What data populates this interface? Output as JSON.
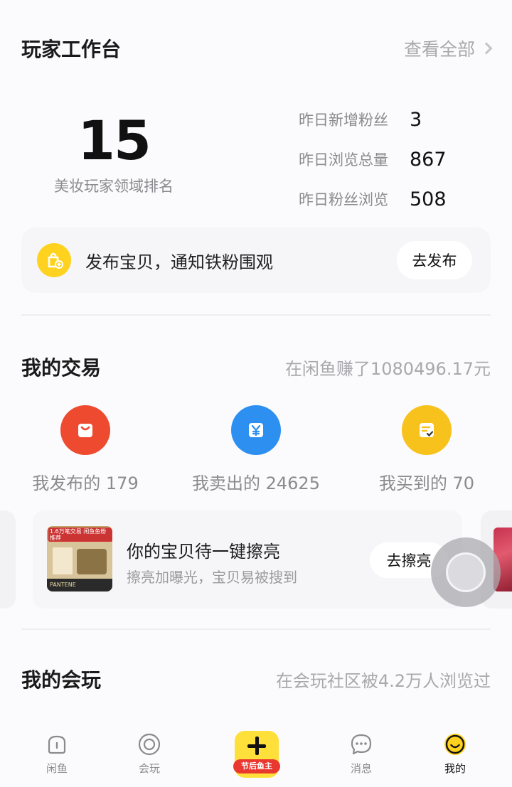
{
  "workbench": {
    "title": "玩家工作台",
    "view_all": "查看全部",
    "rank_value": "15",
    "rank_label": "美妆玩家领域排名",
    "stats": [
      {
        "label": "昨日新增粉丝",
        "value": "3"
      },
      {
        "label": "昨日浏览总量",
        "value": "867"
      },
      {
        "label": "昨日粉丝浏览",
        "value": "508"
      }
    ]
  },
  "publish_card": {
    "text": "发布宝贝，通知铁粉围观",
    "button": "去发布",
    "icon": "shopping-bag-plus-icon"
  },
  "trades": {
    "title": "我的交易",
    "earnings": "在闲鱼赚了1080496.17元",
    "items": [
      {
        "label": "我发布的 179",
        "icon": "bag-icon",
        "color": "#ee4a2f"
      },
      {
        "label": "我卖出的 24625",
        "icon": "yuan-icon",
        "color": "#2d8ff0"
      },
      {
        "label": "我买到的 70",
        "icon": "receipt-check-icon",
        "color": "#f8c21c"
      }
    ]
  },
  "polish_card": {
    "title": "你的宝贝待一键擦亮",
    "subtitle": "擦亮加曝光，宝贝易被搜到",
    "button": "去擦亮",
    "thumb_tag": "1.6万笔交易 闲鱼鱼粉推荐",
    "thumb_brand": "PANTENE"
  },
  "community": {
    "title": "我的会玩",
    "summary": "在会玩社区被4.2万人浏览过"
  },
  "tabbar": {
    "items": [
      {
        "label": "闲鱼",
        "icon": "xianyu-home-icon"
      },
      {
        "label": "会玩",
        "icon": "circle-target-icon"
      },
      {
        "label": "节后鱼主",
        "icon": "plus-icon"
      },
      {
        "label": "消息",
        "icon": "chat-bubble-icon"
      },
      {
        "label": "我的",
        "icon": "smiley-face-icon",
        "active": true
      }
    ]
  },
  "colors": {
    "accent_yellow": "#ffd21f",
    "text_primary": "#1a1a1a",
    "text_secondary": "#8a8a8f"
  }
}
